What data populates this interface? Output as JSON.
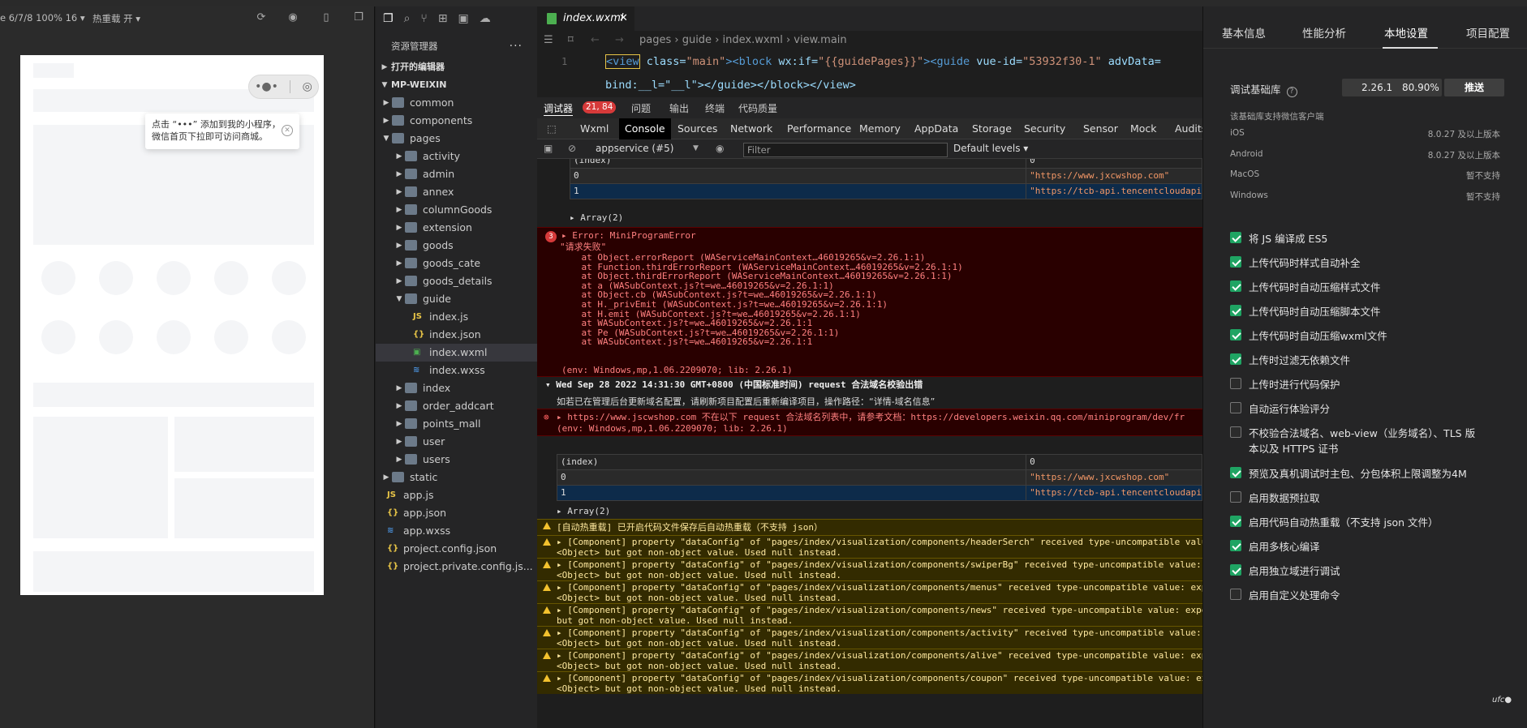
{
  "simulator": {
    "device": "e 6/7/8 100% 16 ▾",
    "hot_reload": "热重载 开 ▾",
    "tip_text": "点击 “•••” 添加到我的小程序，微信首页下拉即可访问商城。"
  },
  "explorer": {
    "header": "资源管理器",
    "more": "···",
    "open_editors": "打开的编辑器",
    "project": "MP-WEIXIN",
    "items": [
      {
        "label": "common",
        "type": "folder",
        "depth": 1
      },
      {
        "label": "components",
        "type": "folder",
        "depth": 1
      },
      {
        "label": "pages",
        "type": "folder-open",
        "depth": 1
      },
      {
        "label": "activity",
        "type": "folder",
        "depth": 2
      },
      {
        "label": "admin",
        "type": "folder",
        "depth": 2
      },
      {
        "label": "annex",
        "type": "folder",
        "depth": 2
      },
      {
        "label": "columnGoods",
        "type": "folder",
        "depth": 2
      },
      {
        "label": "extension",
        "type": "folder",
        "depth": 2
      },
      {
        "label": "goods",
        "type": "folder",
        "depth": 2
      },
      {
        "label": "goods_cate",
        "type": "folder",
        "depth": 2
      },
      {
        "label": "goods_details",
        "type": "folder",
        "depth": 2
      },
      {
        "label": "guide",
        "type": "folder-open",
        "depth": 2
      },
      {
        "label": "index.js",
        "type": "js",
        "depth": 3
      },
      {
        "label": "index.json",
        "type": "json",
        "depth": 3
      },
      {
        "label": "index.wxml",
        "type": "wxml",
        "depth": 3
      },
      {
        "label": "index.wxss",
        "type": "wxss",
        "depth": 3
      },
      {
        "label": "index",
        "type": "folder",
        "depth": 2
      },
      {
        "label": "order_addcart",
        "type": "folder",
        "depth": 2
      },
      {
        "label": "points_mall",
        "type": "folder",
        "depth": 2
      },
      {
        "label": "user",
        "type": "folder",
        "depth": 2
      },
      {
        "label": "users",
        "type": "folder",
        "depth": 2
      },
      {
        "label": "static",
        "type": "folder",
        "depth": 1
      },
      {
        "label": "app.js",
        "type": "js",
        "depth": 1
      },
      {
        "label": "app.json",
        "type": "json",
        "depth": 1
      },
      {
        "label": "app.wxss",
        "type": "wxss",
        "depth": 1
      },
      {
        "label": "project.config.json",
        "type": "json",
        "depth": 1
      },
      {
        "label": "project.private.config.js...",
        "type": "json",
        "depth": 1
      }
    ]
  },
  "editor": {
    "tab": "index.wxml",
    "breadcrumb": "pages › guide › index.wxml › view.main",
    "line_no": "1",
    "line1_a": "<view",
    "line1_b": " class=",
    "line1_c": "\"main\"",
    "line1_d": "><block",
    "line1_e": " wx:if=",
    "line1_f": "\"{{guidePages}}\"",
    "line1_g": "><guide",
    "line1_h": " vue-id=",
    "line1_i": "\"53932f30-1\"",
    "line1_j": " advData=",
    "line2": "bind:__l=\"__l\"></guide></block></view>"
  },
  "devtools": {
    "tabs_top": [
      "调试器",
      "21, 84",
      "问题",
      "输出",
      "终端",
      "代码质量"
    ],
    "tabs": [
      "Wxml",
      "Console",
      "Sources",
      "Network",
      "Performance",
      "Memory",
      "AppData",
      "Storage",
      "Security",
      "Sensor",
      "Mock",
      "Audits"
    ],
    "context": "appservice (#5)",
    "filter_placeholder": "Filter",
    "levels": "Default levels ▾"
  },
  "console": {
    "table1": [
      [
        "(index)",
        "0"
      ],
      [
        "0",
        "\"https://www.jxcwshop.com\""
      ],
      [
        "1",
        "\"https://tcb-api.tencentcloudapi"
      ]
    ],
    "array": "▸ Array(2)",
    "err_count": "3",
    "err_title": "▸ Error: MiniProgramError",
    "err_msg": "\"请求失败\"",
    "stack": [
      "    at Object.errorReport (WAServiceMainContext…46019265&v=2.26.1:1)",
      "    at Function.thirdErrorReport (WAServiceMainContext…46019265&v=2.26.1:1)",
      "    at Object.thirdErrorReport (WAServiceMainContext…46019265&v=2.26.1:1)",
      "    at a (WASubContext.js?t=we…46019265&v=2.26.1:1)",
      "    at Object.cb (WASubContext.js?t=we…46019265&v=2.26.1:1)",
      "    at H._privEmit (WASubContext.js?t=we…46019265&v=2.26.1:1)",
      "    at H.emit (WASubContext.js?t=we…46019265&v=2.26.1:1)",
      "    at WASubContext.js?t=we…46019265&v=2.26.1:1",
      "    at Pe (WASubContext.js?t=we…46019265&v=2.26.1:1)",
      "    at WASubContext.js?t=we…46019265&v=2.26.1:1"
    ],
    "env": "(env: Windows,mp,1.06.2209070; lib: 2.26.1)",
    "group_title": "▾ Wed Sep 28 2022 14:31:30 GMT+0800 (中国标准时间) request 合法域名校验出错",
    "group_msg": "如若已在管理后台更新域名配置，请刷新项目配置后重新编译项目，操作路径：“详情-域名信息”",
    "domain_err": "▸ https://www.jscwshop.com 不在以下 request 合法域名列表中，请参考文档：https://developers.weixin.qq.com/miniprogram/dev/fr",
    "table2": [
      [
        "(index)",
        "0"
      ],
      [
        "0",
        "\"https://www.jxcwshop.com\""
      ],
      [
        "1",
        "\"https://tcb-api.tencentcloudapi"
      ]
    ],
    "hot_warn": "[自动热重载] 已开启代码文件保存后自动热重载（不支持 json）",
    "warns": [
      [
        "▸ [Component] property \"dataConfig\" of \"pages/index/visualization/components/headerSerch\" received type-uncompatible value",
        "<Object> but got non-object value. Used null instead."
      ],
      [
        "▸ [Component] property \"dataConfig\" of \"pages/index/visualization/components/swiperBg\" received type-uncompatible value:",
        "<Object> but got non-object value. Used null instead."
      ],
      [
        "▸ [Component] property \"dataConfig\" of \"pages/index/visualization/components/menus\" received type-uncompatible value: exp",
        "<Object> but got non-object value. Used null instead."
      ],
      [
        "▸ [Component] property \"dataConfig\" of \"pages/index/visualization/components/news\" received type-uncompatible value: expe",
        "but got non-object value. Used null instead."
      ],
      [
        "▸ [Component] property \"dataConfig\" of \"pages/index/visualization/components/activity\" received type-uncompatible value:",
        "<Object> but got non-object value. Used null instead."
      ],
      [
        "▸ [Component] property \"dataConfig\" of \"pages/index/visualization/components/alive\" received type-uncompatible value: exp",
        "<Object> but got non-object value. Used null instead."
      ],
      [
        "▸ [Component] property \"dataConfig\" of \"pages/index/visualization/components/coupon\" received type-uncompatible value: ex",
        "<Object> but got non-object value. Used null instead."
      ]
    ]
  },
  "settings": {
    "tabs": [
      "基本信息",
      "性能分析",
      "本地设置",
      "项目配置"
    ],
    "lib_label": "调试基础库",
    "lib_version": "2.26.1",
    "lib_percent": "80.90%",
    "push": "推送",
    "support_note": "该基础库支持微信客户端",
    "platforms": [
      [
        "iOS",
        "8.0.27 及以上版本"
      ],
      [
        "Android",
        "8.0.27 及以上版本"
      ],
      [
        "MacOS",
        "暂不支持"
      ],
      [
        "Windows",
        "暂不支持"
      ]
    ],
    "options": [
      {
        "label": "将 JS 编译成 ES5",
        "checked": true
      },
      {
        "label": "上传代码时样式自动补全",
        "checked": true
      },
      {
        "label": "上传代码时自动压缩样式文件",
        "checked": true
      },
      {
        "label": "上传代码时自动压缩脚本文件",
        "checked": true
      },
      {
        "label": "上传代码时自动压缩wxml文件",
        "checked": true
      },
      {
        "label": "上传时过滤无依赖文件",
        "checked": true
      },
      {
        "label": "上传时进行代码保护",
        "checked": false
      },
      {
        "label": "自动运行体验评分",
        "checked": false
      },
      {
        "label": "不校验合法域名、web-view（业务域名）、TLS 版",
        "label2": "本以及 HTTPS 证书",
        "checked": false
      },
      {
        "label": "预览及真机调试时主包、分包体积上限调整为4M",
        "checked": true
      },
      {
        "label": "启用数据预拉取",
        "checked": false
      },
      {
        "label": "启用代码自动热重载（不支持 json 文件）",
        "checked": true
      },
      {
        "label": "启用多核心编译",
        "checked": true
      },
      {
        "label": "启用独立域进行调试",
        "checked": true
      },
      {
        "label": "启用自定义处理命令",
        "checked": false
      }
    ]
  }
}
